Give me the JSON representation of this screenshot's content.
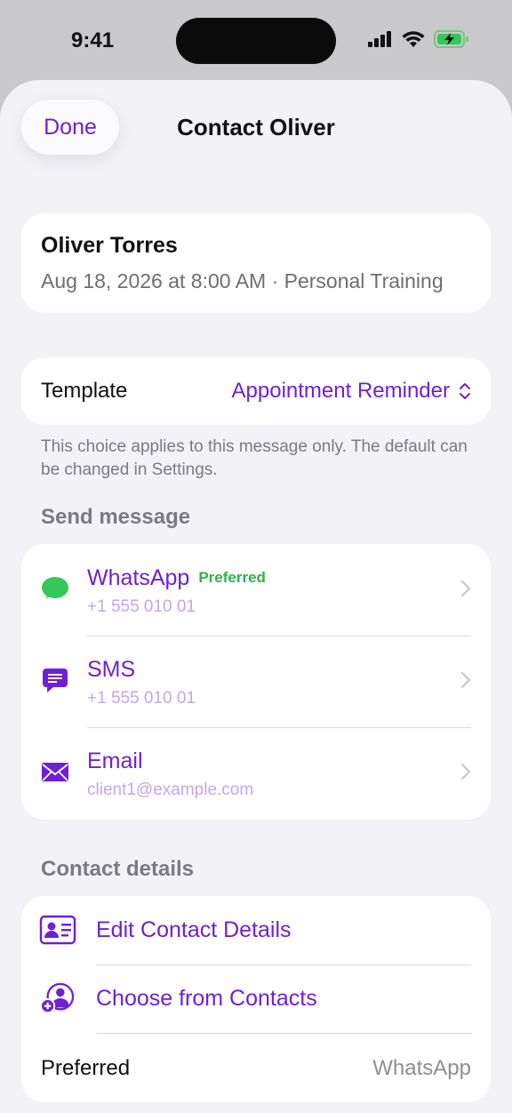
{
  "status_bar": {
    "time": "9:41"
  },
  "header": {
    "done_label": "Done",
    "title": "Contact Oliver"
  },
  "client": {
    "name": "Oliver Torres",
    "details": "Aug 18, 2026 at 8:00 AM · Personal Training"
  },
  "template": {
    "label": "Template",
    "value": "Appointment Reminder"
  },
  "footnote": "This choice applies to this message only. The default can be changed in Settings.",
  "send_message": {
    "header": "Send message",
    "items": [
      {
        "title": "WhatsApp",
        "badge": "Preferred",
        "subtitle": "+1 555 010 01",
        "icon": "whatsapp-icon"
      },
      {
        "title": "SMS",
        "subtitle": "+1 555 010 01",
        "icon": "sms-icon"
      },
      {
        "title": "Email",
        "subtitle": "client1@example.com",
        "icon": "mail-icon"
      }
    ]
  },
  "contact_details": {
    "header": "Contact details",
    "items": [
      {
        "label": "Edit Contact Details",
        "icon": "contact-card-icon"
      },
      {
        "label": "Choose from Contacts",
        "icon": "add-person-icon"
      }
    ],
    "preferred_label": "Preferred",
    "preferred_value": "WhatsApp"
  },
  "colors": {
    "accent": "#6f1fd8",
    "accent_light": "#c3a6ee",
    "preferred_badge": "#2cb34a",
    "whatsapp_green": "#34c759",
    "background": "#f2f2f7"
  }
}
